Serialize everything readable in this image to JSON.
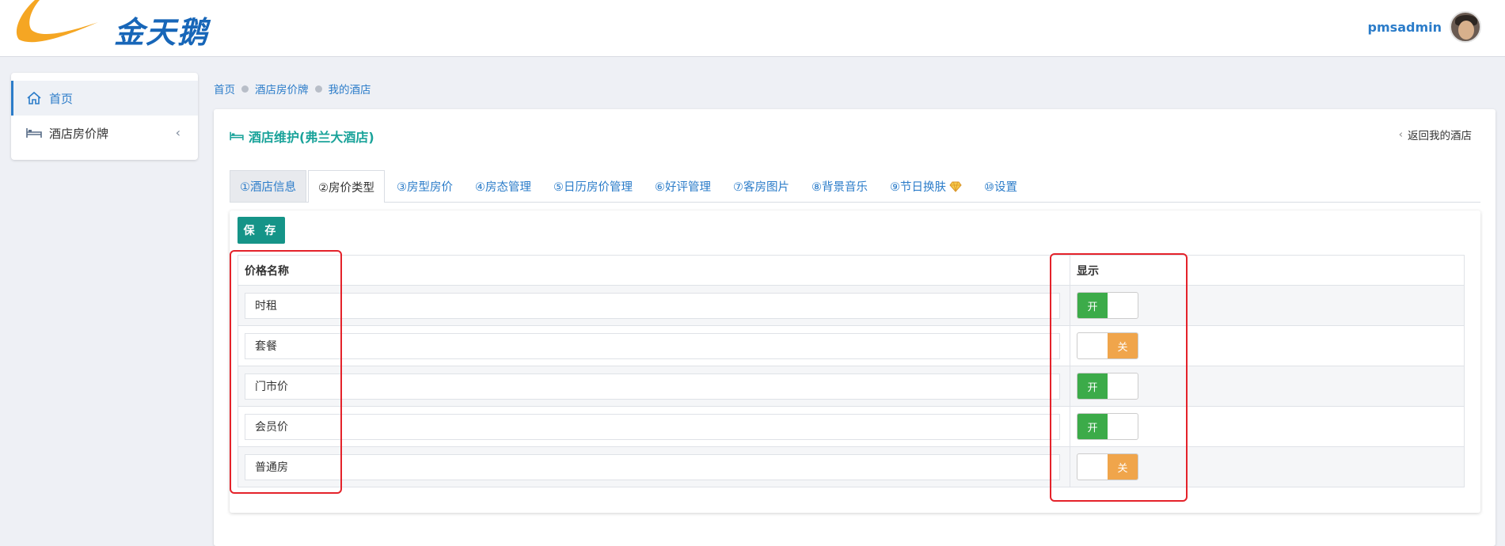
{
  "header": {
    "brand": "金天鹅",
    "username": "pmsadmin",
    "logo_colors": {
      "swoosh": "#f5a623",
      "text": "#1766b8"
    }
  },
  "sidebar": {
    "items": [
      {
        "label": "首页",
        "icon": "home-icon",
        "active": true
      },
      {
        "label": "酒店房价牌",
        "icon": "bed-icon",
        "active": false,
        "has_children": true
      }
    ]
  },
  "breadcrumb": [
    "首页",
    "酒店房价牌",
    "我的酒店"
  ],
  "card": {
    "title": "酒店维护(弗兰大酒店)",
    "back_label": "返回我的酒店"
  },
  "tabs": [
    {
      "label": "①酒店信息"
    },
    {
      "label": "②房价类型",
      "active": true
    },
    {
      "label": "③房型房价"
    },
    {
      "label": "④房态管理"
    },
    {
      "label": "⑤日历房价管理"
    },
    {
      "label": "⑥好评管理"
    },
    {
      "label": "⑦客房图片"
    },
    {
      "label": "⑧背景音乐"
    },
    {
      "label": "⑨节日换肤"
    },
    {
      "label": "⑩设置"
    }
  ],
  "form": {
    "save_label": "保 存",
    "columns": [
      "价格名称",
      "显示"
    ],
    "rows": [
      {
        "name": "时租",
        "show": true
      },
      {
        "name": "套餐",
        "show": false
      },
      {
        "name": "门市价",
        "show": true
      },
      {
        "name": "会员价",
        "show": true
      },
      {
        "name": "普通房",
        "show": false
      }
    ],
    "toggle_on_label": "开",
    "toggle_off_label": "关"
  },
  "colors": {
    "accent": "#159488",
    "link": "#2b7cc9",
    "toggle_on": "#3cab49",
    "toggle_off": "#f0a54b",
    "highlight_box": "#e4222a"
  }
}
